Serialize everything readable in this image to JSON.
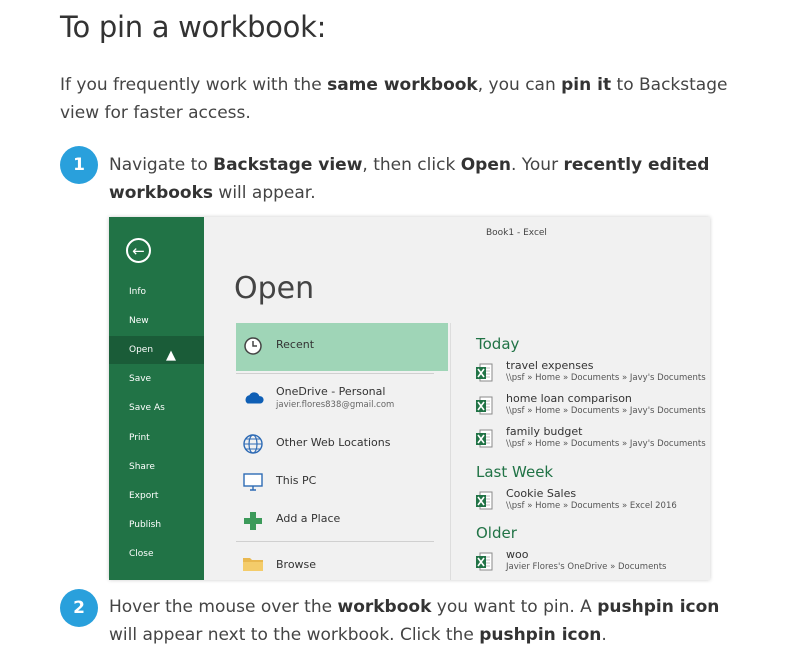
{
  "title": "To pin a workbook:",
  "intro": {
    "t1": "If you frequently work with the ",
    "b1": "same workbook",
    "t2": ", you can ",
    "b2": "pin it",
    "t3": " to Backstage view for faster access."
  },
  "steps": [
    {
      "num": "1",
      "t1": "Navigate to ",
      "b1": "Backstage view",
      "t2": ", then click ",
      "b2": "Open",
      "t3": ". Your ",
      "b3": "recently edited workbooks",
      "t4": " will appear."
    },
    {
      "num": "2",
      "t1": "Hover the mouse over the ",
      "b1": "workbook",
      "t2": " you want to pin. A ",
      "b2": "pushpin icon",
      "t3": " will appear next to the workbook. Click the ",
      "b3": "pushpin icon",
      "t4": "."
    }
  ],
  "screenshot": {
    "window_title": "Book1 - Excel",
    "heading": "Open",
    "back_icon": "arrow-left-circle-icon",
    "sidebar": [
      "Info",
      "New",
      "Open",
      "Save",
      "Save As",
      "Print",
      "Share",
      "Export",
      "Publish",
      "Close"
    ],
    "active_item": "Open",
    "locations": [
      {
        "label": "Recent",
        "icon": "clock-icon"
      },
      {
        "label": "OneDrive - Personal",
        "sub": "javier.flores838@gmail.com",
        "icon": "cloud-icon"
      },
      {
        "label": "Other Web Locations",
        "icon": "globe-icon"
      },
      {
        "label": "This PC",
        "icon": "computer-icon"
      },
      {
        "label": "Add a Place",
        "icon": "plus-icon"
      },
      {
        "label": "Browse",
        "icon": "folder-icon"
      }
    ],
    "groups": [
      {
        "name": "Today",
        "files": [
          {
            "name": "travel expenses",
            "path": "\\\\psf » Home » Documents » Javy's Documents"
          },
          {
            "name": "home loan comparison",
            "path": "\\\\psf » Home » Documents » Javy's Documents"
          },
          {
            "name": "family budget",
            "path": "\\\\psf » Home » Documents » Javy's Documents"
          }
        ]
      },
      {
        "name": "Last Week",
        "files": [
          {
            "name": "Cookie Sales",
            "path": "\\\\psf » Home » Documents » Excel 2016"
          }
        ]
      },
      {
        "name": "Older",
        "files": [
          {
            "name": "woo",
            "path": "Javier Flores's OneDrive » Documents"
          }
        ]
      }
    ]
  },
  "colors": {
    "accent": "#29a0dc",
    "excel_green": "#217346",
    "selected": "#9fd5b7"
  }
}
